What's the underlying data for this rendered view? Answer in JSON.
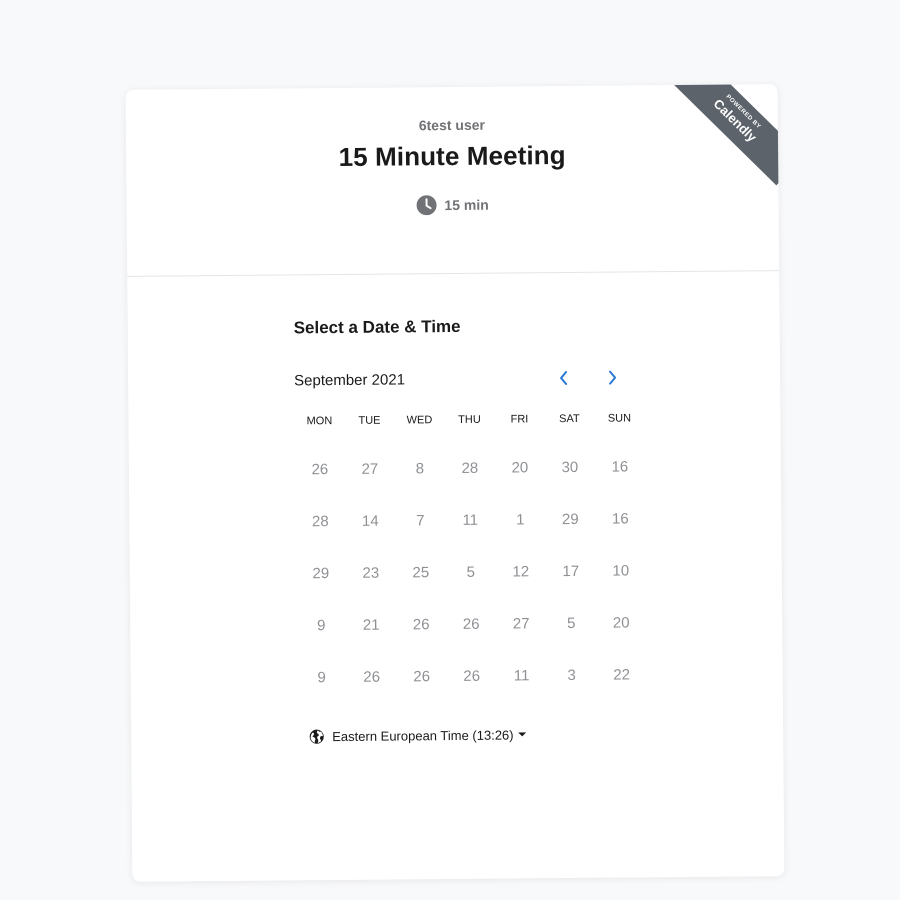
{
  "header": {
    "owner": "6test user",
    "event_title": "15 Minute Meeting",
    "duration": "15 min",
    "duration_icon": "clock-icon"
  },
  "badge": {
    "line1": "POWERED BY",
    "brand": "Calendly",
    "color": "#5c636a"
  },
  "calendar": {
    "section_title": "Select a Date & Time",
    "month": "September 2021",
    "prev_icon": "chevron-left-icon",
    "next_icon": "chevron-right-icon",
    "accent": "#2a7ad5",
    "weekdays": [
      "MON",
      "TUE",
      "WED",
      "THU",
      "FRI",
      "SAT",
      "SUN"
    ],
    "weeks": [
      [
        "26",
        "27",
        "8",
        "28",
        "20",
        "30",
        "16"
      ],
      [
        "28",
        "14",
        "7",
        "11",
        "1",
        "29",
        "16"
      ],
      [
        "29",
        "23",
        "25",
        "5",
        "12",
        "17",
        "10"
      ],
      [
        "9",
        "21",
        "26",
        "26",
        "27",
        "5",
        "20"
      ],
      [
        "9",
        "26",
        "26",
        "26",
        "11",
        "3",
        "22"
      ]
    ]
  },
  "timezone": {
    "label": "Eastern European Time (13:26)",
    "icon": "globe-icon"
  }
}
